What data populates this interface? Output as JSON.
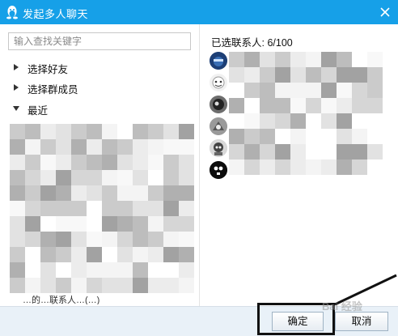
{
  "window": {
    "title": "发起多人聊天"
  },
  "search": {
    "placeholder": "输入查找关键字"
  },
  "groups": [
    {
      "label": "选择好友",
      "expanded": false
    },
    {
      "label": "选择群成员",
      "expanded": false
    },
    {
      "label": "最近",
      "expanded": true
    }
  ],
  "recent_partial_text": "…的…联系人…(…)",
  "selected": {
    "label": "已选联系人: 6/100",
    "count": 6,
    "max": 100
  },
  "buttons": {
    "ok": "确定",
    "cancel": "取消"
  },
  "watermark": "Bai 经验",
  "colors": {
    "titlebar": "#16a0e8",
    "footer": "#e9f1f8",
    "highlight": "#111111"
  },
  "icons": {
    "app": "qq-penguin-icon",
    "close": "close-icon"
  }
}
